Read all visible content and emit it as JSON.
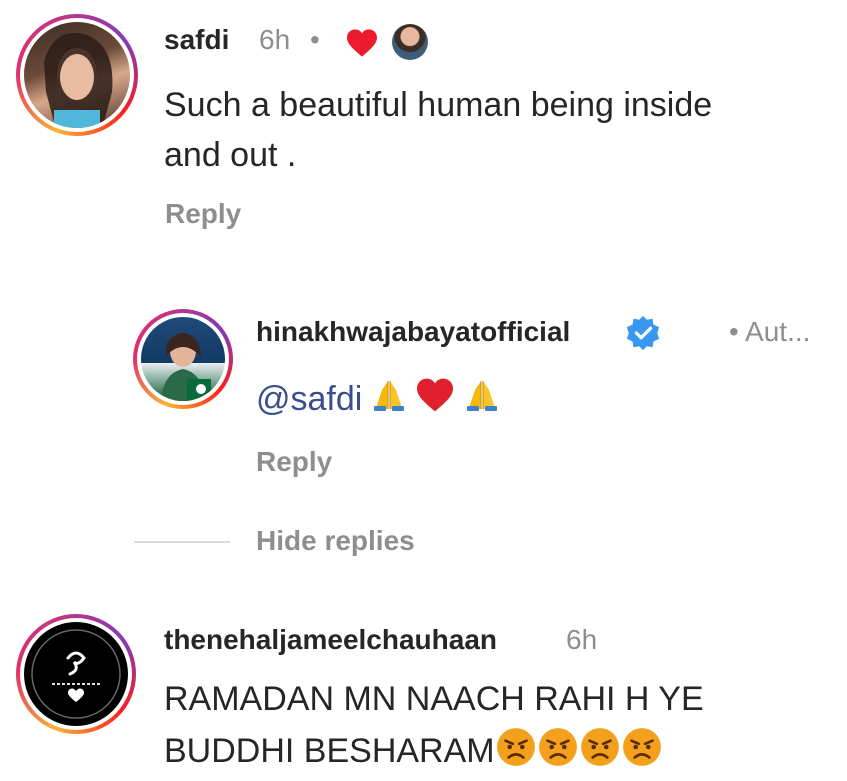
{
  "comments": [
    {
      "username": "safdi",
      "time": "6h",
      "dot": "•",
      "text_line1": "Such a beautiful human being inside",
      "text_line2": "and out .",
      "reply_label": "Reply"
    },
    {
      "username": "hinakhwajabayatofficial",
      "meta": "• Aut...",
      "mention": "@safdi",
      "reply_label": "Reply",
      "hide_replies": "Hide replies"
    },
    {
      "username": "thenehaljameelchauhaan",
      "time": "6h",
      "text_line1": "RAMADAN MN NAACH RAHI H YE",
      "text_line2": "BUDDHI BESHARAM"
    }
  ],
  "colors": {
    "verified": "#3897f0",
    "heart": "#ed1b2e",
    "mention": "#3a4e8c",
    "secondary_text": "#8e8e8e"
  },
  "icons": [
    "heart-icon",
    "verified-badge-icon",
    "pray-emoji",
    "heart-emoji",
    "angry-emoji"
  ]
}
